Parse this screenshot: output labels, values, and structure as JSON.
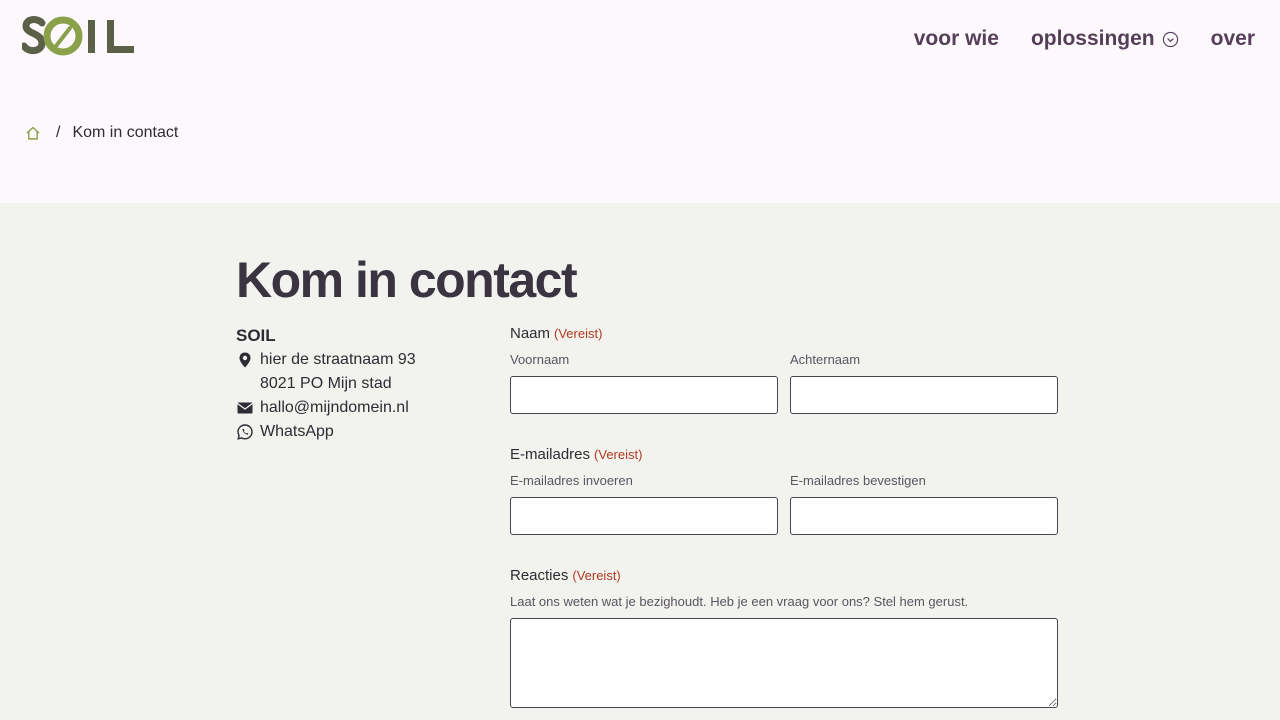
{
  "header": {
    "logo_text": "SOIL",
    "nav": [
      {
        "label": "voor wie"
      },
      {
        "label": "oplossingen"
      },
      {
        "label": "over"
      }
    ]
  },
  "breadcrumb": {
    "current": "Kom in contact",
    "separator": "/"
  },
  "page_title": "Kom in contact",
  "contact": {
    "org": "SOIL",
    "address_line1": "hier de straatnaam 93",
    "address_line2": "8021 PO Mijn stad",
    "email": "hallo@mijndomein.nl",
    "whatsapp": "WhatsApp"
  },
  "form": {
    "name": {
      "label": "Naam",
      "required": "(Vereist)",
      "first_label": "Voornaam",
      "last_label": "Achternaam",
      "first_value": "",
      "last_value": ""
    },
    "email": {
      "label": "E-mailadres",
      "required": "(Vereist)",
      "enter_label": "E-mailadres invoeren",
      "confirm_label": "E-mailadres bevestigen",
      "enter_value": "",
      "confirm_value": ""
    },
    "comments": {
      "label": "Reacties",
      "required": "(Vereist)",
      "description": "Laat ons weten wat je bezighoudt. Heb je een vraag voor ons? Stel hem gerust.",
      "value": ""
    }
  },
  "colors": {
    "brand_dark": "#5a6148",
    "brand_green": "#8aa04a",
    "nav_text": "#553f58",
    "required": "#b03a1f",
    "header_bg": "#fdf8fc",
    "content_bg": "#f2f2ee"
  }
}
